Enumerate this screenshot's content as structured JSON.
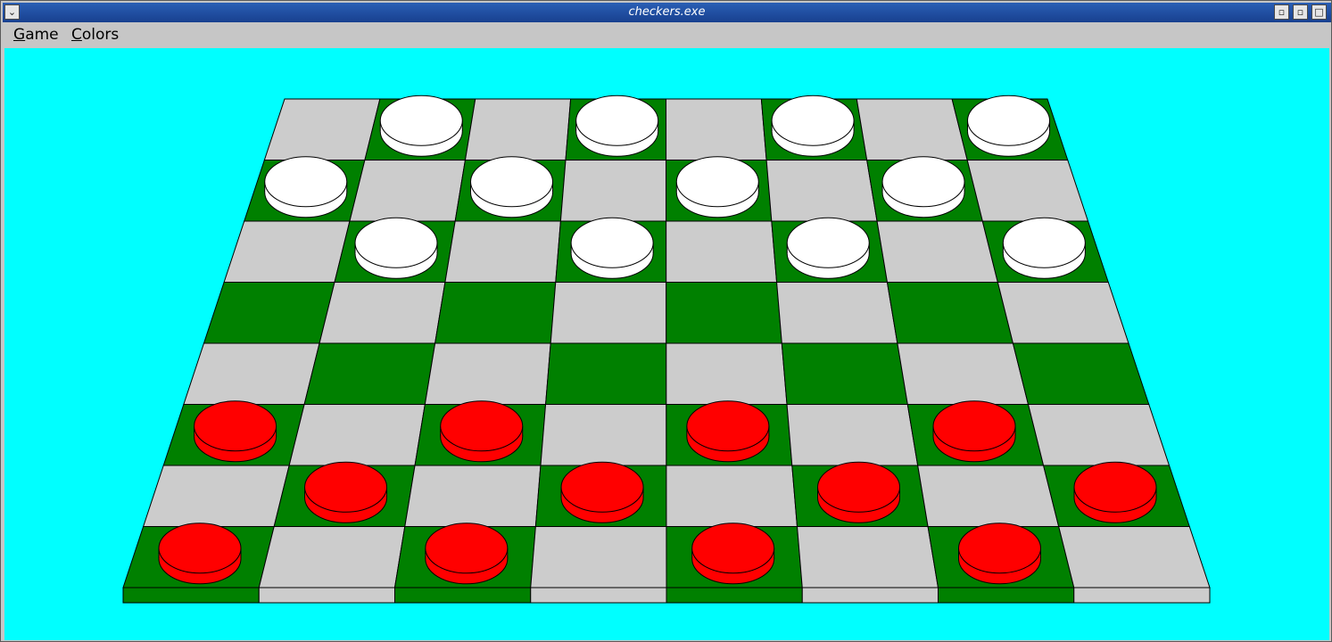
{
  "window": {
    "title": "checkers.exe"
  },
  "title_buttons": [
    {
      "name": "window-menu-button",
      "glyph": "⌄"
    },
    {
      "name": "minimize-button",
      "glyph": "▫"
    },
    {
      "name": "maximize-button",
      "glyph": "□"
    }
  ],
  "menu": [
    {
      "mnemonic": "G",
      "rest": "ame"
    },
    {
      "mnemonic": "C",
      "rest": "olors"
    }
  ],
  "colors": {
    "background": "#00ffff",
    "light_square": "#cccccc",
    "dark_square": "#008000",
    "white_piece": "#ffffff",
    "red_piece": "#ff0000"
  },
  "board": {
    "rows": 8,
    "cols": 8,
    "pieces": [
      {
        "row": 0,
        "col": 1,
        "color": "white"
      },
      {
        "row": 0,
        "col": 3,
        "color": "white"
      },
      {
        "row": 0,
        "col": 5,
        "color": "white"
      },
      {
        "row": 0,
        "col": 7,
        "color": "white"
      },
      {
        "row": 1,
        "col": 0,
        "color": "white"
      },
      {
        "row": 1,
        "col": 2,
        "color": "white"
      },
      {
        "row": 1,
        "col": 4,
        "color": "white"
      },
      {
        "row": 1,
        "col": 6,
        "color": "white"
      },
      {
        "row": 2,
        "col": 1,
        "color": "white"
      },
      {
        "row": 2,
        "col": 3,
        "color": "white"
      },
      {
        "row": 2,
        "col": 5,
        "color": "white"
      },
      {
        "row": 2,
        "col": 7,
        "color": "white"
      },
      {
        "row": 5,
        "col": 0,
        "color": "red"
      },
      {
        "row": 5,
        "col": 2,
        "color": "red"
      },
      {
        "row": 5,
        "col": 4,
        "color": "red"
      },
      {
        "row": 5,
        "col": 6,
        "color": "red"
      },
      {
        "row": 6,
        "col": 1,
        "color": "red"
      },
      {
        "row": 6,
        "col": 3,
        "color": "red"
      },
      {
        "row": 6,
        "col": 5,
        "color": "red"
      },
      {
        "row": 6,
        "col": 7,
        "color": "red"
      },
      {
        "row": 7,
        "col": 0,
        "color": "red"
      },
      {
        "row": 7,
        "col": 2,
        "color": "red"
      },
      {
        "row": 7,
        "col": 4,
        "color": "red"
      },
      {
        "row": 7,
        "col": 6,
        "color": "red"
      }
    ]
  }
}
